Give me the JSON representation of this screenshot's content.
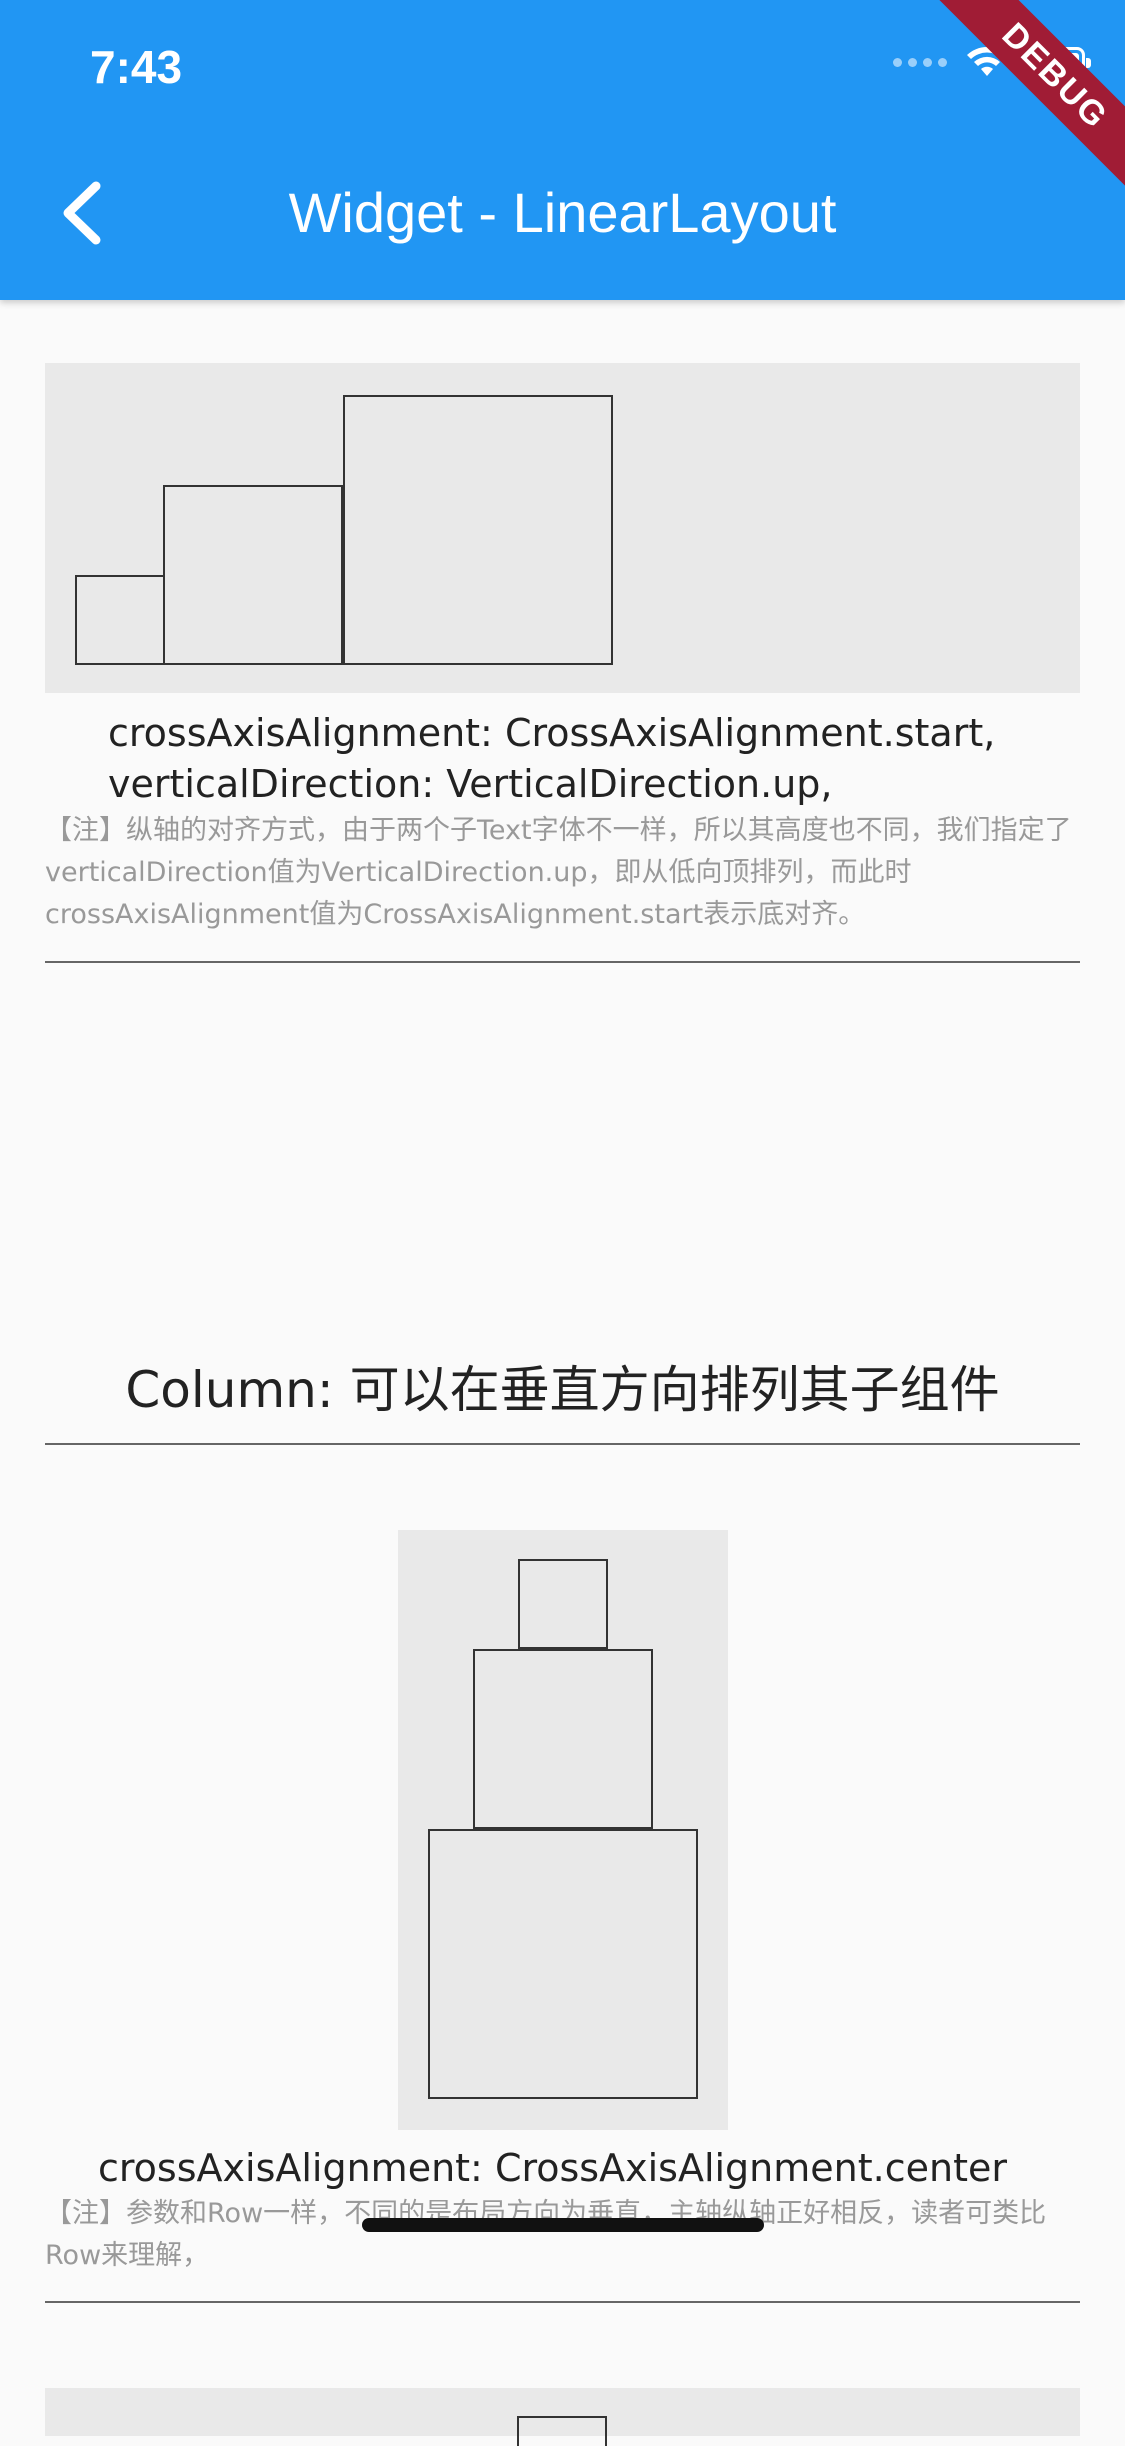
{
  "status_bar": {
    "time": "7:43"
  },
  "app_bar": {
    "title": "Widget - LinearLayout",
    "debug_banner": "DEBUG"
  },
  "row_example": {
    "caption_line1": "crossAxisAlignment: CrossAxisAlignment.start,",
    "caption_line2": "verticalDirection: VerticalDirection.up,",
    "note": "【注】纵轴的对齐方式，由于两个子Text字体不一样，所以其高度也不同，我们指定了verticalDirection值为VerticalDirection.up，即从低向顶排列，而此时crossAxisAlignment值为CrossAxisAlignment.start表示底对齐。"
  },
  "column_section": {
    "title": "Column: 可以在垂直方向排列其子组件",
    "caption": "crossAxisAlignment: CrossAxisAlignment.center",
    "note": "【注】参数和Row一样，不同的是布局方向为垂直，主轴纵轴正好相反，读者可类比Row来理解，"
  },
  "icons": {
    "back": "chevron-left-icon",
    "wifi": "wifi-icon",
    "battery": "battery-icon"
  },
  "colors": {
    "app_bar": "#2196f3",
    "debug_banner": "#a01c35",
    "panel_bg": "#e9e9e9",
    "page_bg": "#fafafa"
  }
}
